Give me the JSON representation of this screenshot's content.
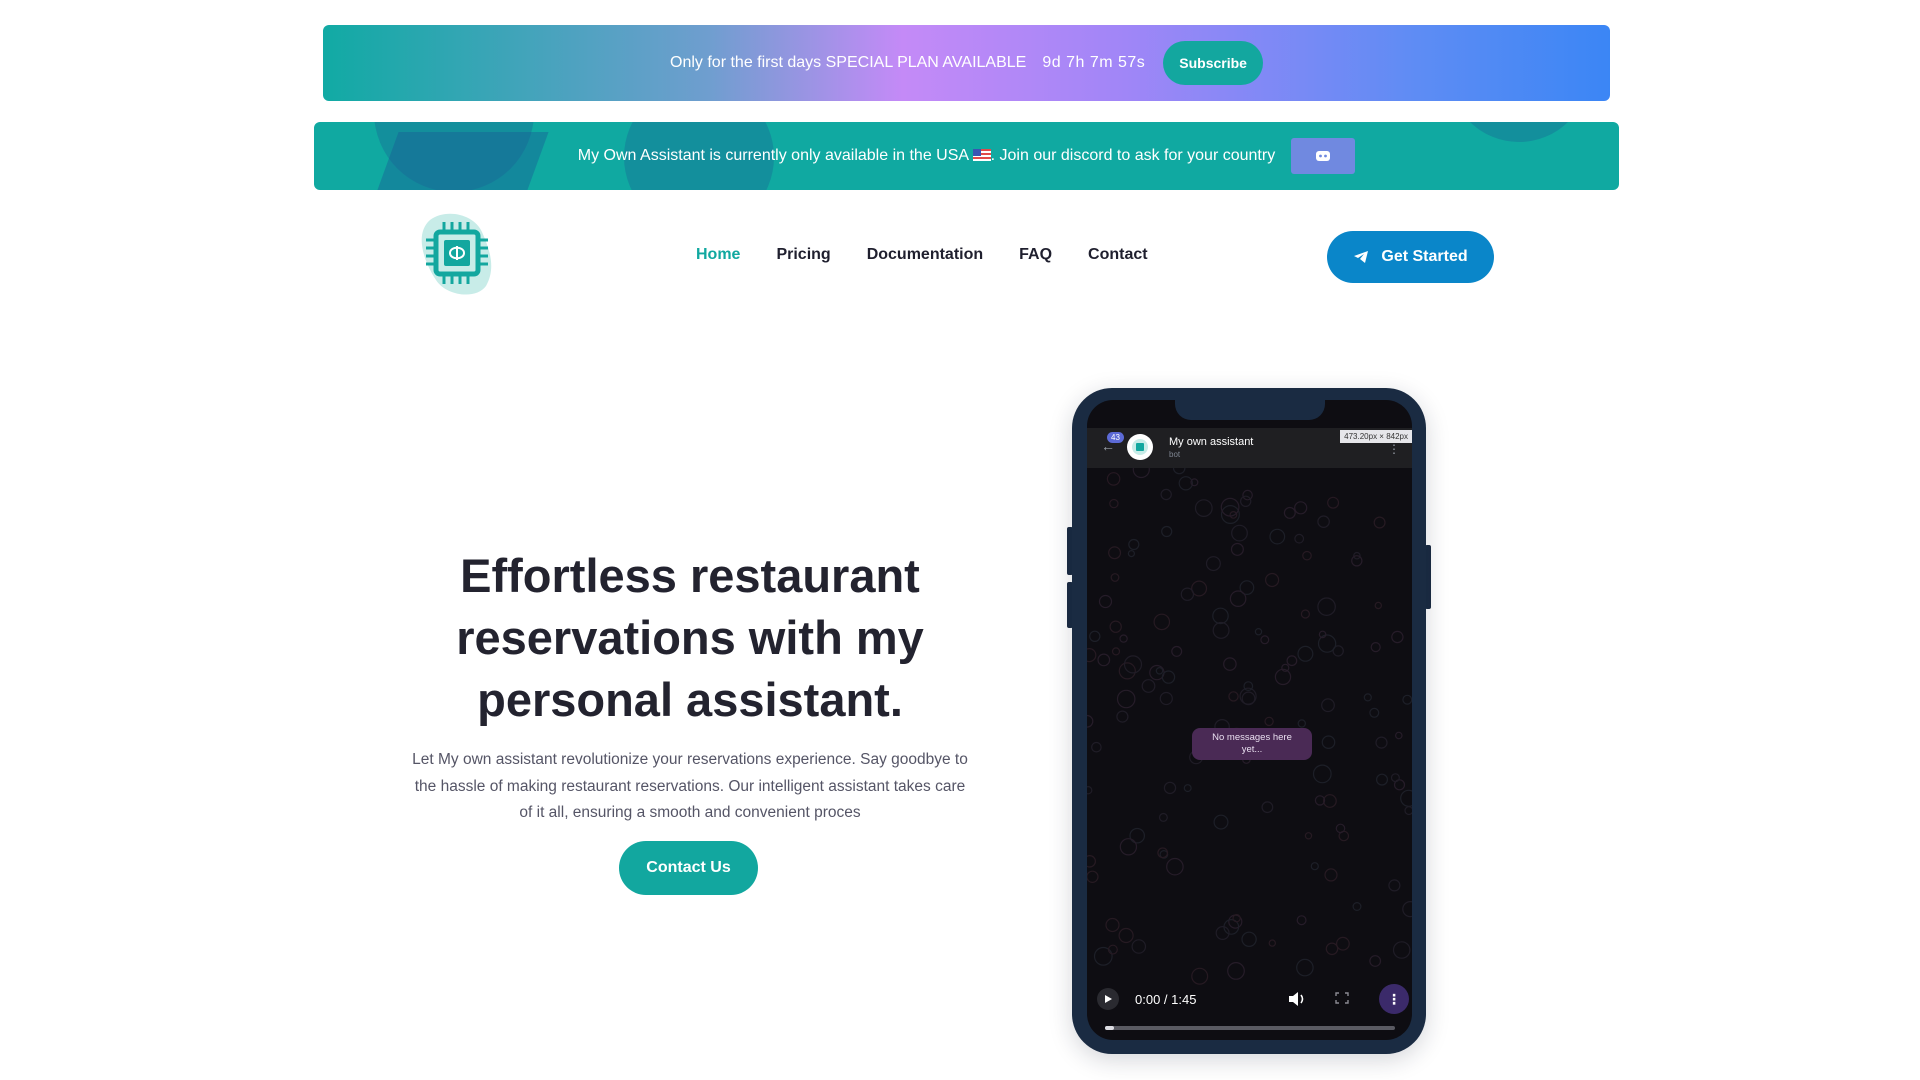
{
  "promo": {
    "text": "Only for the first days SPECIAL PLAN AVAILABLE",
    "countdown": "9d 7h 7m 57s",
    "subscribe_label": "Subscribe"
  },
  "info": {
    "text_before": "My Own Assistant is currently only available in the USA",
    "text_after": ". Join our discord to ask for your country",
    "discord_icon": "discord-icon"
  },
  "nav": {
    "items": [
      {
        "label": "Home",
        "active": true
      },
      {
        "label": "Pricing",
        "active": false
      },
      {
        "label": "Documentation",
        "active": false
      },
      {
        "label": "FAQ",
        "active": false
      },
      {
        "label": "Contact",
        "active": false
      }
    ],
    "cta_label": "Get Started"
  },
  "hero": {
    "title": "Effortless restaurant reservations with my personal assistant.",
    "description": "Let My own assistant revolutionize your reservations experience. Say goodbye to the hassle of making restaurant reservations. Our intelligent assistant takes care of it all, ensuring a smooth and convenient proces",
    "contact_label": "Contact Us"
  },
  "phone": {
    "badge_count": "43",
    "chat_name": "My own assistant",
    "chat_status": "bot",
    "dimension_label": "473.20px × 842px",
    "empty_message": "No messages here yet...",
    "video_time": "0:00 / 1:45",
    "video_progress": 0.03
  },
  "colors": {
    "accent": "#11a8a0",
    "cta_blue": "#0a86c9",
    "text_dark": "#23232f"
  }
}
